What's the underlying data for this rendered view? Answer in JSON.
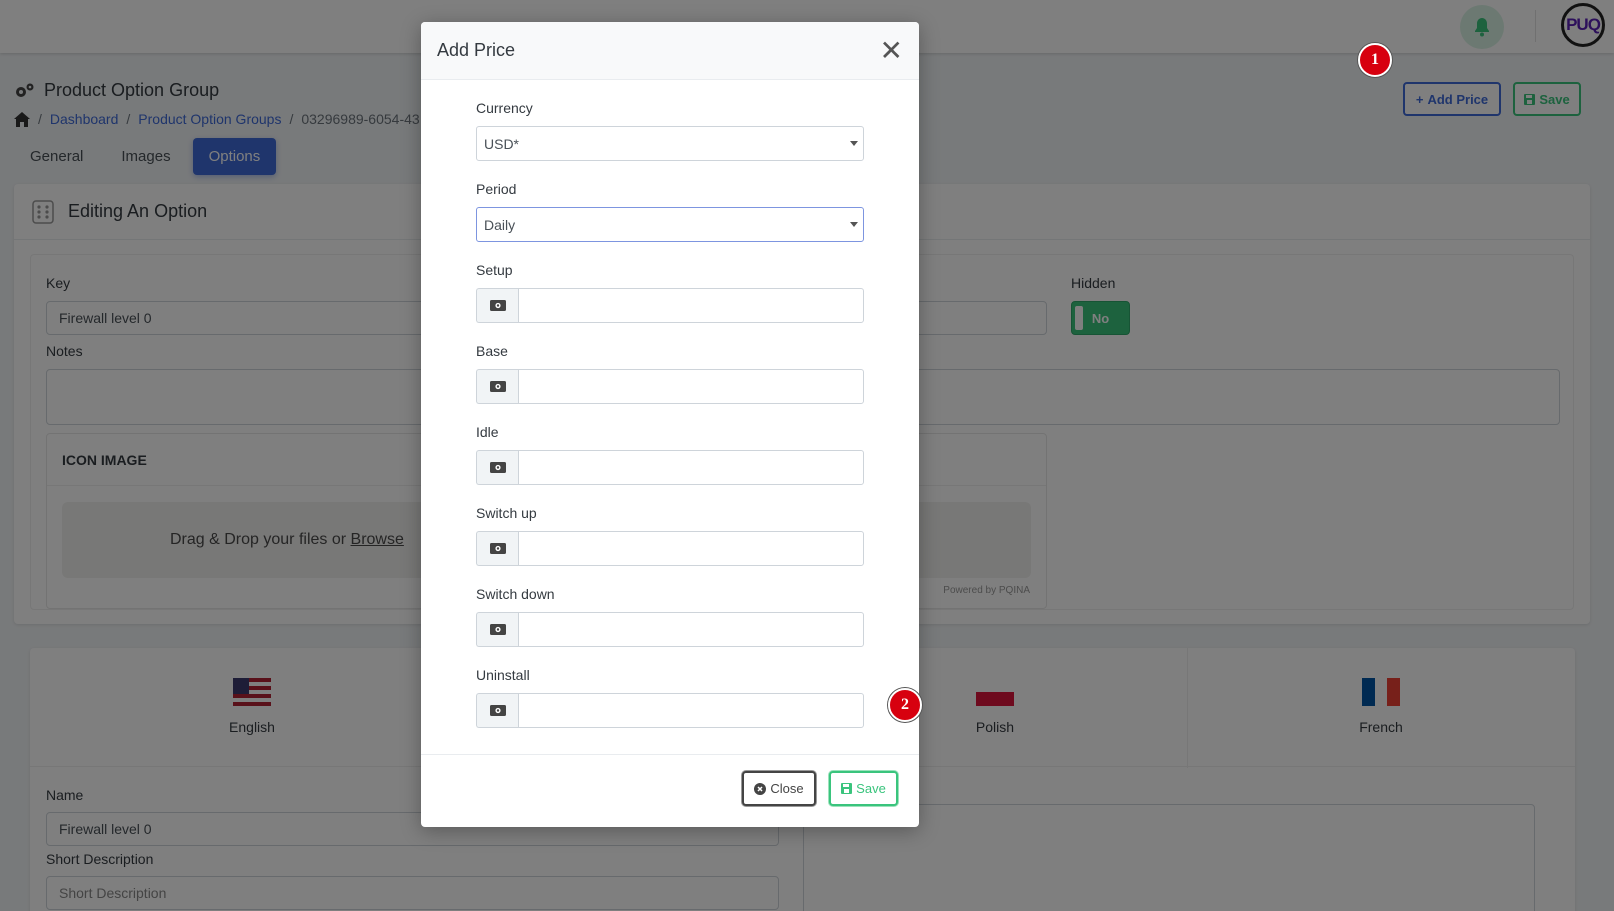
{
  "topbar": {
    "logo_text": "PUQ"
  },
  "page": {
    "title": "Product Option Group",
    "breadcrumb": [
      "Dashboard",
      "Product Option Groups",
      "03296989-6054-43"
    ],
    "tabs": [
      "General",
      "Images",
      "Options"
    ],
    "active_tab": "Options",
    "add_price_label": "Add Price",
    "save_label": "Save"
  },
  "badges": [
    "1",
    "2"
  ],
  "option": {
    "header": "Editing An Option",
    "key_label": "Key",
    "key_value": "Firewall level 0",
    "hidden_label": "Hidden",
    "hidden_value": "No",
    "notes_label": "Notes",
    "icon_image_label": "ICON IMAGE",
    "dropzone_text": "Drag & Drop your files or ",
    "dropzone_browse": "Browse",
    "powered_by": "Powered by PQINA"
  },
  "languages": [
    {
      "label": "English",
      "flag": "us-flag"
    },
    {
      "label": "Polish",
      "flag": "pl-flag"
    },
    {
      "label": "French",
      "flag": "fr-flag"
    }
  ],
  "translation": {
    "name_label": "Name",
    "name_value": "Firewall level 0",
    "short_desc_label": "Short Description",
    "short_desc_placeholder": "Short Description"
  },
  "modal": {
    "title": "Add Price",
    "currency_label": "Currency",
    "currency_value": "USD*",
    "period_label": "Period",
    "period_value": "Daily",
    "price_fields": [
      "Setup",
      "Base",
      "Idle",
      "Switch up",
      "Switch down",
      "Uninstall"
    ],
    "close_label": "Close",
    "save_label": "Save"
  },
  "colors": {
    "primary": "#3f6ad8",
    "success": "#3ac47d",
    "badge": "#d7000f"
  }
}
